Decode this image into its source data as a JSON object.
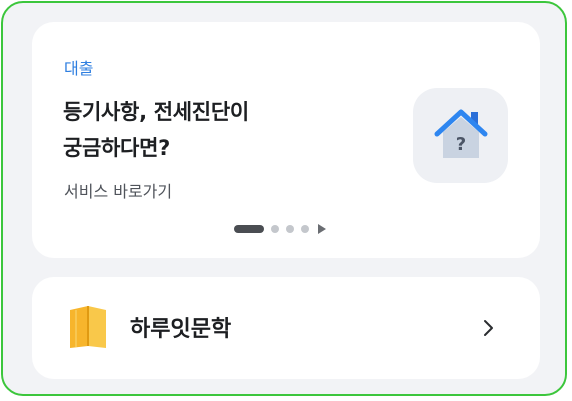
{
  "promo": {
    "category": "대출",
    "title_line1": "등기사항, 전세진단이",
    "title_line2": "궁금하다면?",
    "subtitle": "서비스 바로가기",
    "icon": "house-question-icon",
    "pager": {
      "total": 4,
      "active_index": 0,
      "control": "play-icon"
    }
  },
  "link_card": {
    "label": "하루잇문학",
    "icon": "book-icon",
    "chevron": "chevron-right-icon"
  },
  "colors": {
    "frame_border": "#3cc63c",
    "background": "#f2f3f6",
    "accent_blue": "#2f7fe0",
    "book_yellow": "#f7b52c"
  }
}
